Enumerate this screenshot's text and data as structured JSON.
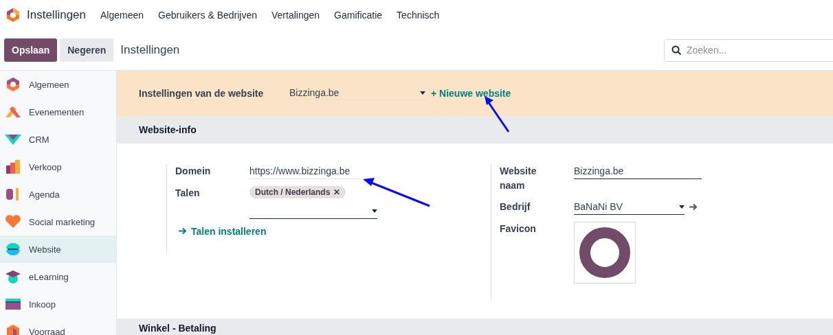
{
  "navbar": {
    "app_title": "Instellingen",
    "menu": [
      "Algemeen",
      "Gebruikers & Bedrijven",
      "Vertalingen",
      "Gamificatie",
      "Technisch"
    ]
  },
  "control_panel": {
    "buttons": [
      {
        "label": "Opslaan",
        "kind": "primary"
      },
      {
        "label": "Negeren",
        "kind": "secondary"
      }
    ],
    "breadcrumb": "Instellingen",
    "search": {
      "placeholder": "Zoeken..."
    }
  },
  "sidebar": {
    "items": [
      {
        "label": "Algemeen",
        "selected": false
      },
      {
        "label": "Evenementen",
        "selected": false
      },
      {
        "label": "CRM",
        "selected": false
      },
      {
        "label": "Verkoop",
        "selected": false
      },
      {
        "label": "Agenda",
        "selected": false
      },
      {
        "label": "Social marketing",
        "selected": false
      },
      {
        "label": "Website",
        "selected": true
      },
      {
        "label": "eLearning",
        "selected": false
      },
      {
        "label": "Inkoop",
        "selected": false
      },
      {
        "label": "Voorraad",
        "selected": false
      }
    ]
  },
  "website_bar": {
    "label": "Instellingen van de website",
    "value": "Bizzinga.be",
    "link": "+ Nieuwe website"
  },
  "sections": [
    {
      "title": "Website-info"
    },
    {
      "title": "Winkel - Betaling"
    }
  ],
  "website_info": {
    "left": {
      "domain_label": "Domein",
      "domain_value": "https://www.bizzinga.be",
      "languages_label": "Talen",
      "tags": [
        "Dutch / Nederlands"
      ],
      "tag_remove": "✕",
      "install_link": "Talen installeren"
    },
    "right": {
      "name_label": "Website naam",
      "name_value": "Bizzinga.be",
      "company_label": "Bedrijf",
      "company_value": "BaNaNi BV",
      "favicon_label": "Favicon"
    }
  }
}
